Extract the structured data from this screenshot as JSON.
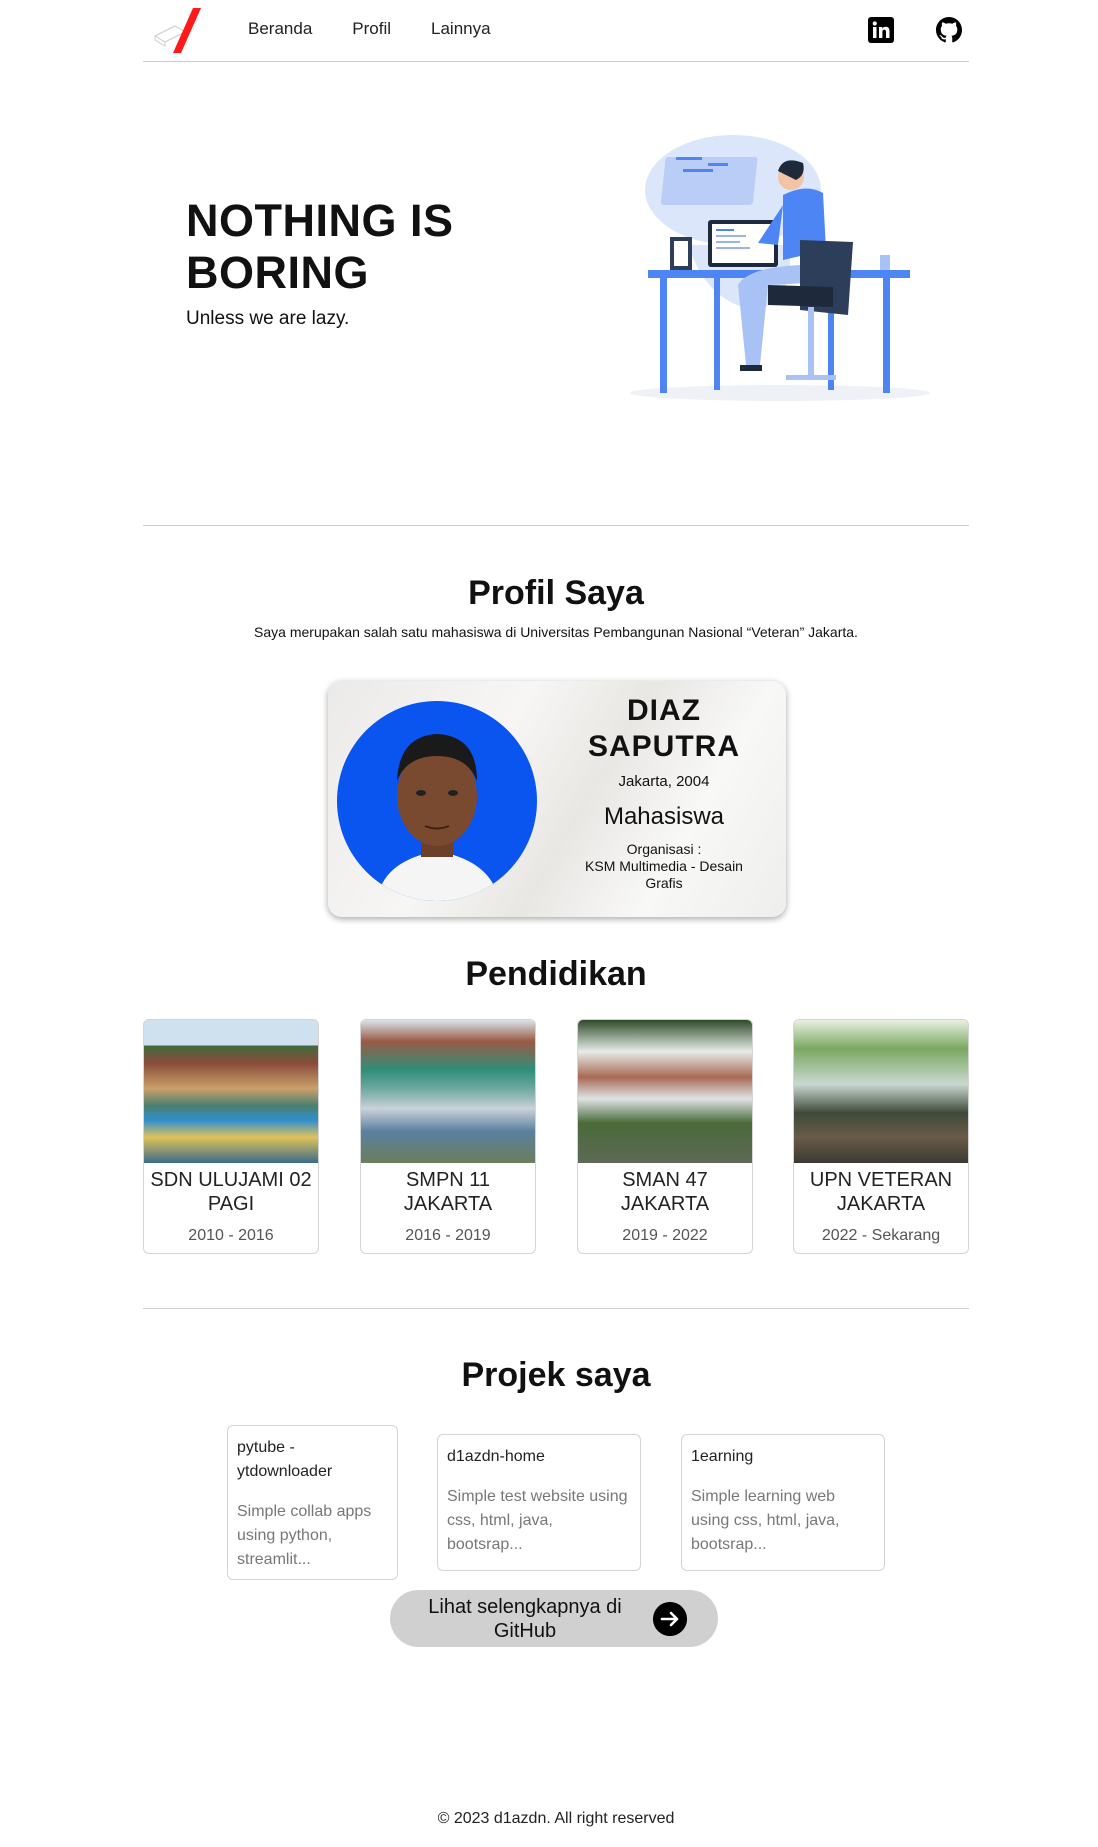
{
  "nav": {
    "links": [
      "Beranda",
      "Profil",
      "Lainnya"
    ],
    "linkedin_icon": "linkedin-icon",
    "github_icon": "github-icon"
  },
  "hero": {
    "title_line1": "NOTHING IS",
    "title_line2": "BORING",
    "subtitle": "Unless we are lazy."
  },
  "profile": {
    "heading": "Profil Saya",
    "description": "Saya merupakan salah satu mahasiswa di Universitas Pembangunan Nasional “Veteran” Jakarta.",
    "name_line1": "DIAZ",
    "name_line2": "SAPUTRA",
    "born": "Jakarta, 2004",
    "role": "Mahasiswa",
    "org_label": "Organisasi :",
    "org_value": "KSM Multimedia - Desain Grafis"
  },
  "education": {
    "heading": "Pendidikan",
    "items": [
      {
        "name": "SDN ULUJAMI 02 PAGI",
        "years": "2010 - 2016"
      },
      {
        "name": "SMPN 11 JAKARTA",
        "years": "2016 - 2019"
      },
      {
        "name": "SMAN 47 JAKARTA",
        "years": "2019 - 2022"
      },
      {
        "name": "UPN VETERAN JAKARTA",
        "years": "2022 - Sekarang"
      }
    ]
  },
  "projects": {
    "heading": "Projek saya",
    "items": [
      {
        "title": "pytube - ytdownloader",
        "desc": "Simple collab apps using python, streamlit..."
      },
      {
        "title": "d1azdn-home",
        "desc": "Simple test website using css, html, java, bootsrap..."
      },
      {
        "title": "1earning",
        "desc": "Simple learning web using css, html, java, bootsrap..."
      }
    ],
    "more_button": "Lihat selengkapnya di GitHub"
  },
  "footer": {
    "copyright": "© 2023 d1azdn. All right reserved"
  },
  "colors": {
    "accent_red": "#ff1a1a",
    "photo_bg": "#0a55f0",
    "illustration_blue": "#4d85f5"
  }
}
